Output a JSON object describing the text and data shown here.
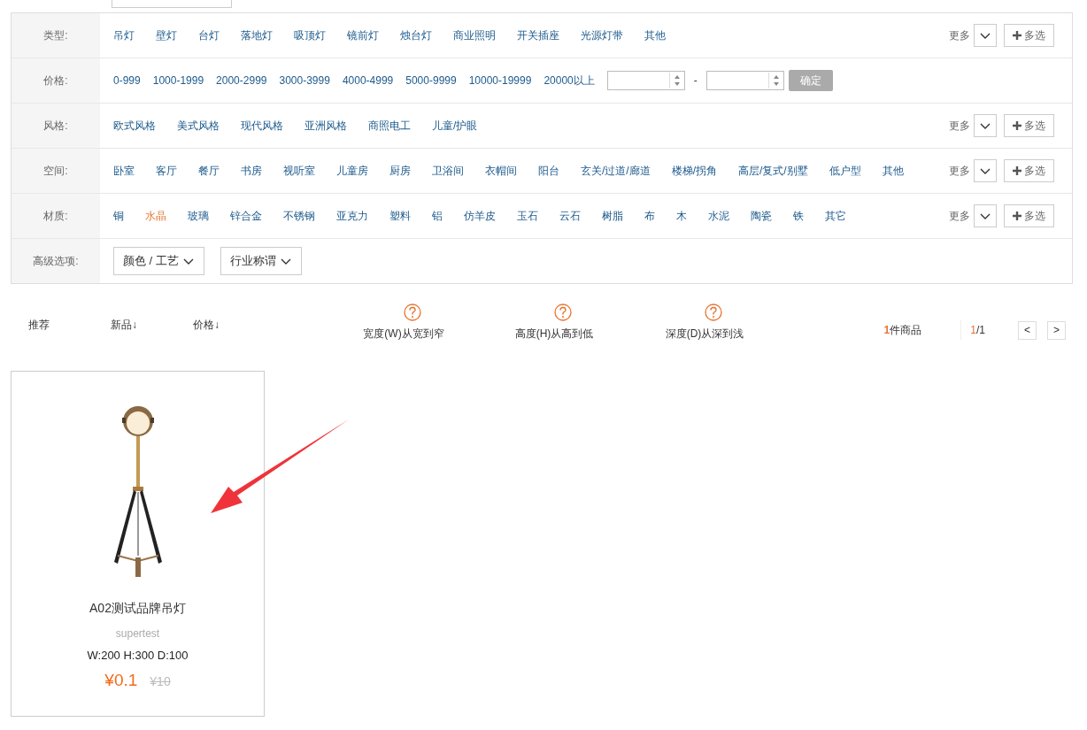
{
  "filters": [
    {
      "kind": "options",
      "label": "类型:",
      "more": "更多",
      "multi": "多选",
      "options": [
        {
          "text": "吊灯",
          "selected": false
        },
        {
          "text": "壁灯",
          "selected": false
        },
        {
          "text": "台灯",
          "selected": false
        },
        {
          "text": "落地灯",
          "selected": false
        },
        {
          "text": "吸顶灯",
          "selected": false
        },
        {
          "text": "镜前灯",
          "selected": false
        },
        {
          "text": "烛台灯",
          "selected": false
        },
        {
          "text": "商业照明",
          "selected": false
        },
        {
          "text": "开关插座",
          "selected": false
        },
        {
          "text": "光源灯带",
          "selected": false
        },
        {
          "text": "其他",
          "selected": false
        }
      ]
    },
    {
      "kind": "price",
      "label": "价格:",
      "separator": "-",
      "confirm": "确定",
      "options": [
        {
          "text": "0-999",
          "selected": false
        },
        {
          "text": "1000-1999",
          "selected": false
        },
        {
          "text": "2000-2999",
          "selected": false
        },
        {
          "text": "3000-3999",
          "selected": false
        },
        {
          "text": "4000-4999",
          "selected": false
        },
        {
          "text": "5000-9999",
          "selected": false
        },
        {
          "text": "10000-19999",
          "selected": false
        },
        {
          "text": "20000以上",
          "selected": false
        }
      ]
    },
    {
      "kind": "options",
      "label": "风格:",
      "more": "更多",
      "multi": "多选",
      "options": [
        {
          "text": "欧式风格",
          "selected": false
        },
        {
          "text": "美式风格",
          "selected": false
        },
        {
          "text": "现代风格",
          "selected": false
        },
        {
          "text": "亚洲风格",
          "selected": false
        },
        {
          "text": "商照电工",
          "selected": false
        },
        {
          "text": "儿童/护眼",
          "selected": false
        }
      ]
    },
    {
      "kind": "options",
      "label": "空间:",
      "more": "更多",
      "multi": "多选",
      "options": [
        {
          "text": "卧室",
          "selected": false
        },
        {
          "text": "客厅",
          "selected": false
        },
        {
          "text": "餐厅",
          "selected": false
        },
        {
          "text": "书房",
          "selected": false
        },
        {
          "text": "视听室",
          "selected": false
        },
        {
          "text": "儿童房",
          "selected": false
        },
        {
          "text": "厨房",
          "selected": false
        },
        {
          "text": "卫浴间",
          "selected": false
        },
        {
          "text": "衣帽间",
          "selected": false
        },
        {
          "text": "阳台",
          "selected": false
        },
        {
          "text": "玄关/过道/廊道",
          "selected": false
        },
        {
          "text": "楼梯/拐角",
          "selected": false
        },
        {
          "text": "高层/复式/别墅",
          "selected": false
        },
        {
          "text": "低户型",
          "selected": false
        },
        {
          "text": "其他",
          "selected": false
        }
      ]
    },
    {
      "kind": "options",
      "label": "材质:",
      "more": "更多",
      "multi": "多选",
      "options": [
        {
          "text": "铜",
          "selected": false
        },
        {
          "text": "水晶",
          "selected": true
        },
        {
          "text": "玻璃",
          "selected": false
        },
        {
          "text": "锌合金",
          "selected": false
        },
        {
          "text": "不锈钢",
          "selected": false
        },
        {
          "text": "亚克力",
          "selected": false
        },
        {
          "text": "塑料",
          "selected": false
        },
        {
          "text": "铝",
          "selected": false
        },
        {
          "text": "仿羊皮",
          "selected": false
        },
        {
          "text": "玉石",
          "selected": false
        },
        {
          "text": "云石",
          "selected": false
        },
        {
          "text": "树脂",
          "selected": false
        },
        {
          "text": "布",
          "selected": false
        },
        {
          "text": "木",
          "selected": false
        },
        {
          "text": "水泥",
          "selected": false
        },
        {
          "text": "陶瓷",
          "selected": false
        },
        {
          "text": "铁",
          "selected": false
        },
        {
          "text": "其它",
          "selected": false
        }
      ]
    },
    {
      "kind": "dropdowns",
      "label": "高级选项:",
      "dropdowns": [
        "颜色 / 工艺",
        "行业称谓"
      ]
    }
  ],
  "sort": {
    "items": [
      {
        "kind": "plain",
        "label": "推荐"
      },
      {
        "kind": "plain",
        "label": "新品↓"
      },
      {
        "kind": "plain",
        "label": "价格↓"
      },
      {
        "kind": "help",
        "label": "宽度(W)从宽到窄"
      },
      {
        "kind": "help",
        "label": "高度(H)从高到低"
      },
      {
        "kind": "help",
        "label": "深度(D)从深到浅"
      }
    ],
    "count": "**1**件商品",
    "page_current": "1",
    "page_total": "/1",
    "prev": "<",
    "next": ">"
  },
  "products": [
    {
      "title": "A02测试品牌吊灯",
      "brand": "supertest",
      "dims": "W:200 H:300 D:100",
      "price": "¥0.1",
      "old_price": "¥10"
    }
  ]
}
